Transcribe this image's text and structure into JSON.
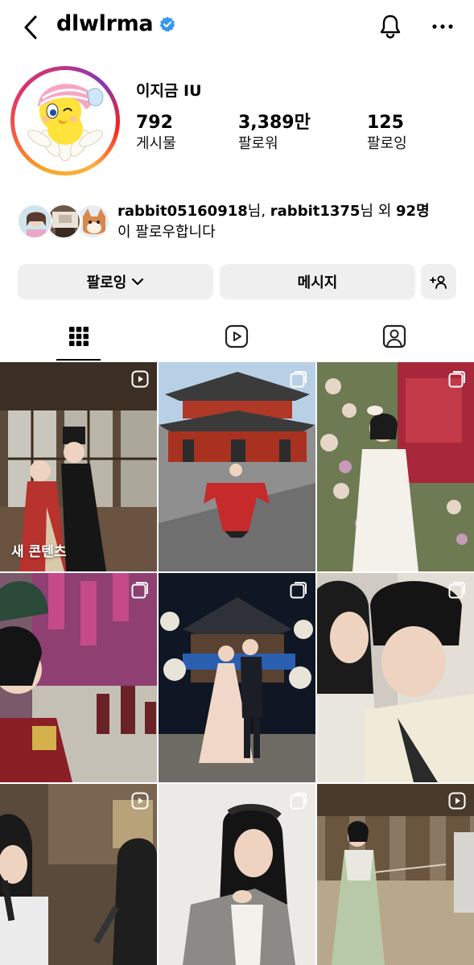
{
  "header": {
    "username": "dlwlrma",
    "verified": true,
    "back_icon": "chevron-left-icon",
    "bell_icon": "bell-icon",
    "more_icon": "more-horizontal-icon"
  },
  "profile": {
    "display_name": "이지금 IU",
    "stats": [
      {
        "value": "792",
        "label": "게시물"
      },
      {
        "value": "3,389만",
        "label": "팔로워"
      },
      {
        "value": "125",
        "label": "팔로잉"
      }
    ]
  },
  "mutual": {
    "line1_part1": "rabbit05160918",
    "line1_part2": "님, ",
    "line1_part3": "rabbit1375",
    "line1_part4": "님 외 ",
    "line1_part5": "92명",
    "line2": "이 팔로우합니다"
  },
  "actions": {
    "following_label": "팔로잉",
    "message_label": "메시지",
    "add_person_icon": "add-person-icon"
  },
  "tabs": [
    {
      "name": "grid",
      "icon": "grid-icon",
      "active": true
    },
    {
      "name": "reels",
      "icon": "reels-icon",
      "active": false
    },
    {
      "name": "tagged",
      "icon": "tagged-person-icon",
      "active": false
    }
  ],
  "grid": {
    "new_content_caption": "새 콘텐츠",
    "tiles": [
      {
        "type": "reel",
        "caption": true
      },
      {
        "type": "carousel"
      },
      {
        "type": "carousel"
      },
      {
        "type": "carousel"
      },
      {
        "type": "carousel"
      },
      {
        "type": "carousel"
      },
      {
        "type": "reel"
      },
      {
        "type": "carousel"
      },
      {
        "type": "reel"
      }
    ]
  },
  "colors": {
    "verified_blue": "#3897f0",
    "button_bg": "#efefef",
    "text": "#000000"
  }
}
